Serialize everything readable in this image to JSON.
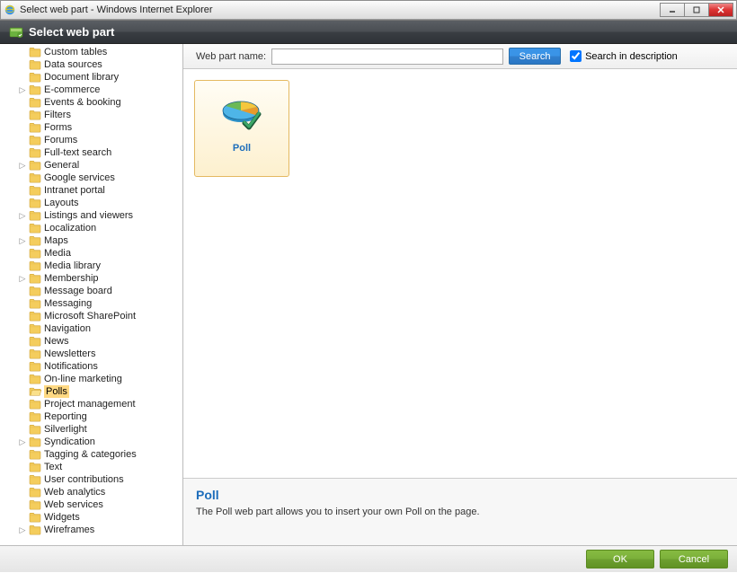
{
  "window": {
    "title": "Select web part - Windows Internet Explorer"
  },
  "header": {
    "title": "Select web part"
  },
  "search": {
    "label": "Web part name:",
    "value": "",
    "button": "Search",
    "checkbox_label": "Search in description"
  },
  "tree": [
    {
      "label": "Custom tables",
      "expandable": false
    },
    {
      "label": "Data sources",
      "expandable": false
    },
    {
      "label": "Document library",
      "expandable": false
    },
    {
      "label": "E-commerce",
      "expandable": true
    },
    {
      "label": "Events & booking",
      "expandable": false
    },
    {
      "label": "Filters",
      "expandable": false
    },
    {
      "label": "Forms",
      "expandable": false
    },
    {
      "label": "Forums",
      "expandable": false
    },
    {
      "label": "Full-text search",
      "expandable": false
    },
    {
      "label": "General",
      "expandable": true
    },
    {
      "label": "Google services",
      "expandable": false
    },
    {
      "label": "Intranet portal",
      "expandable": false
    },
    {
      "label": "Layouts",
      "expandable": false
    },
    {
      "label": "Listings and viewers",
      "expandable": true
    },
    {
      "label": "Localization",
      "expandable": false
    },
    {
      "label": "Maps",
      "expandable": true
    },
    {
      "label": "Media",
      "expandable": false
    },
    {
      "label": "Media library",
      "expandable": false
    },
    {
      "label": "Membership",
      "expandable": true
    },
    {
      "label": "Message board",
      "expandable": false
    },
    {
      "label": "Messaging",
      "expandable": false
    },
    {
      "label": "Microsoft SharePoint",
      "expandable": false
    },
    {
      "label": "Navigation",
      "expandable": false
    },
    {
      "label": "News",
      "expandable": false
    },
    {
      "label": "Newsletters",
      "expandable": false
    },
    {
      "label": "Notifications",
      "expandable": false
    },
    {
      "label": "On-line marketing",
      "expandable": false
    },
    {
      "label": "Polls",
      "expandable": false,
      "selected": true
    },
    {
      "label": "Project management",
      "expandable": false
    },
    {
      "label": "Reporting",
      "expandable": false
    },
    {
      "label": "Silverlight",
      "expandable": false
    },
    {
      "label": "Syndication",
      "expandable": true
    },
    {
      "label": "Tagging & categories",
      "expandable": false
    },
    {
      "label": "Text",
      "expandable": false
    },
    {
      "label": "User contributions",
      "expandable": false
    },
    {
      "label": "Web analytics",
      "expandable": false
    },
    {
      "label": "Web services",
      "expandable": false
    },
    {
      "label": "Widgets",
      "expandable": false
    },
    {
      "label": "Wireframes",
      "expandable": true
    }
  ],
  "gallery": {
    "items": [
      {
        "name": "Poll"
      }
    ]
  },
  "description": {
    "title": "Poll",
    "text": "The Poll web part allows you to insert your own Poll on the page."
  },
  "footer": {
    "ok": "OK",
    "cancel": "Cancel"
  }
}
